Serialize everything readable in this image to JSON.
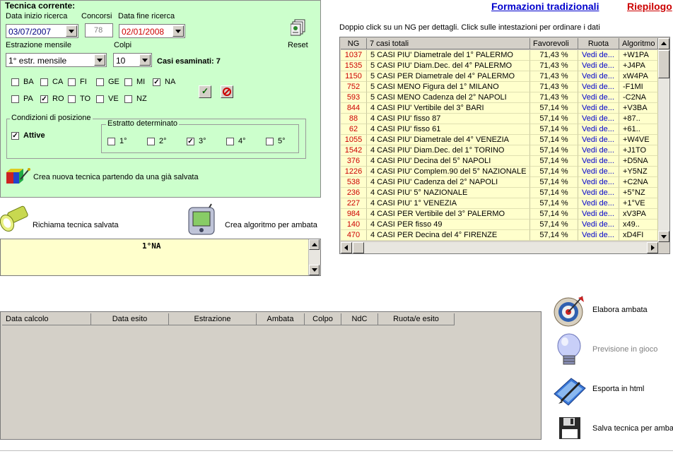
{
  "top_links": {
    "formazioni": "Formazioni tradizionali",
    "riepilogo": "Riepilogo"
  },
  "colors": {
    "panel_bg": "#ccffcc",
    "grid_bg": "#ffffcc",
    "link_blue": "#0000cc",
    "link_red": "#cc0000",
    "ng_red": "#cc0000",
    "ruota_blue": "#0000cc"
  },
  "tecnica": {
    "title": "Tecnica corrente:",
    "data_inizio_label": "Data inizio ricerca",
    "data_inizio_value": "03/07/2007",
    "concorsi_label": "Concorsi",
    "concorsi_value": "78",
    "data_fine_label": "Data fine ricerca",
    "data_fine_value": "02/01/2008",
    "reset_label": "Reset",
    "estrazione_label": "Estrazione mensile",
    "estrazione_value": "1° estr. mensile",
    "colpi_label": "Colpi",
    "colpi_value": "10",
    "casi_esaminati": "Casi esaminati: 7",
    "ruote": [
      {
        "name": "BA",
        "checked": false
      },
      {
        "name": "CA",
        "checked": false
      },
      {
        "name": "FI",
        "checked": false
      },
      {
        "name": "GE",
        "checked": false
      },
      {
        "name": "MI",
        "checked": false
      },
      {
        "name": "NA",
        "checked": true
      },
      {
        "name": "PA",
        "checked": false
      },
      {
        "name": "RO",
        "checked": true
      },
      {
        "name": "TO",
        "checked": false
      },
      {
        "name": "VE",
        "checked": false
      },
      {
        "name": "NZ",
        "checked": false
      }
    ],
    "condizioni_title": "Condizioni di posizione",
    "attive_label": "Attive",
    "attive_checked": true,
    "estratto_title": "Estratto determinato",
    "estratti": [
      {
        "label": "1°",
        "checked": false
      },
      {
        "label": "2°",
        "checked": false
      },
      {
        "label": "3°",
        "checked": true
      },
      {
        "label": "4°",
        "checked": false
      },
      {
        "label": "5°",
        "checked": false
      }
    ],
    "crea_nuova_label": "Crea nuova tecnica partendo da una già salvata"
  },
  "richiama_label": "Richiama tecnica salvata",
  "crea_algoritmo_label": "Crea algoritmo per ambata",
  "textarea_value": "1°NA",
  "instructions": "Doppio click su un NG per dettagli. Click sulle intestazioni per ordinare i dati",
  "casi_table": {
    "headers": [
      "NG",
      "7 casi totali",
      "Favorevoli",
      "Ruota",
      "Algoritmo"
    ],
    "rows": [
      {
        "ng": "1037",
        "desc": "5 CASI PIU' Diametrale del 1° PALERMO",
        "fav": "71,43 %",
        "ruota": "Vedi de...",
        "alg": "+W1PA"
      },
      {
        "ng": "1535",
        "desc": "5 CASI PIU' Diam.Dec. del 4° PALERMO",
        "fav": "71,43 %",
        "ruota": "Vedi de...",
        "alg": "+J4PA"
      },
      {
        "ng": "1150",
        "desc": "5 CASI PER Diametrale del 4° PALERMO",
        "fav": "71,43 %",
        "ruota": "Vedi de...",
        "alg": "xW4PA"
      },
      {
        "ng": "752",
        "desc": "5 CASI MENO Figura del 1° MILANO",
        "fav": "71,43 %",
        "ruota": "Vedi de...",
        "alg": "-F1MI"
      },
      {
        "ng": "593",
        "desc": "5 CASI MENO Cadenza del 2° NAPOLI",
        "fav": "71,43 %",
        "ruota": "Vedi de...",
        "alg": "-C2NA"
      },
      {
        "ng": "844",
        "desc": "4 CASI PIU' Vertibile del 3° BARI",
        "fav": "57,14 %",
        "ruota": "Vedi de...",
        "alg": "+V3BA"
      },
      {
        "ng": "88",
        "desc": "4 CASI PIU' fisso 87",
        "fav": "57,14 %",
        "ruota": "Vedi de...",
        "alg": "+87.."
      },
      {
        "ng": "62",
        "desc": "4 CASI PIU' fisso 61",
        "fav": "57,14 %",
        "ruota": "Vedi de...",
        "alg": "+61.."
      },
      {
        "ng": "1055",
        "desc": "4 CASI PIU' Diametrale del 4° VENEZIA",
        "fav": "57,14 %",
        "ruota": "Vedi de...",
        "alg": "+W4VE"
      },
      {
        "ng": "1542",
        "desc": "4 CASI PIU' Diam.Dec. del 1° TORINO",
        "fav": "57,14 %",
        "ruota": "Vedi de...",
        "alg": "+J1TO"
      },
      {
        "ng": "376",
        "desc": "4 CASI PIU' Decina del 5° NAPOLI",
        "fav": "57,14 %",
        "ruota": "Vedi de...",
        "alg": "+D5NA"
      },
      {
        "ng": "1226",
        "desc": "4 CASI PIU' Complem.90 del 5° NAZIONALE",
        "fav": "57,14 %",
        "ruota": "Vedi de...",
        "alg": "+Y5NZ"
      },
      {
        "ng": "538",
        "desc": "4 CASI PIU' Cadenza del 2° NAPOLI",
        "fav": "57,14 %",
        "ruota": "Vedi de...",
        "alg": "+C2NA"
      },
      {
        "ng": "236",
        "desc": "4 CASI PIU' 5° NAZIONALE",
        "fav": "57,14 %",
        "ruota": "Vedi de...",
        "alg": "+5°NZ"
      },
      {
        "ng": "227",
        "desc": "4 CASI PIU' 1° VENEZIA",
        "fav": "57,14 %",
        "ruota": "Vedi de...",
        "alg": "+1°VE"
      },
      {
        "ng": "984",
        "desc": "4 CASI PER Vertibile del 3° PALERMO",
        "fav": "57,14 %",
        "ruota": "Vedi de...",
        "alg": "xV3PA"
      },
      {
        "ng": "140",
        "desc": "4 CASI PER fisso 49",
        "fav": "57,14 %",
        "ruota": "Vedi de...",
        "alg": "x49.."
      },
      {
        "ng": "470",
        "desc": "4 CASI PER Decina del 4° FIRENZE",
        "fav": "57,14 %",
        "ruota": "Vedi de...",
        "alg": "xD4FI"
      }
    ]
  },
  "risultati_table": {
    "headers": [
      "Data calcolo",
      "Data esito",
      "Estrazione",
      "Ambata",
      "Colpo",
      "NdC",
      "Ruota/e esito"
    ]
  },
  "actions": {
    "elabora": "Elabora ambata",
    "previsione": "Previsione in gioco",
    "esporta": "Esporta in html",
    "salva": "Salva tecnica per ambata"
  },
  "icons": {
    "reset": "document-stack-icon",
    "crea_nuova": "cube-wand-icon",
    "richiama": "flashlight-icon",
    "crea_algoritmo": "handheld-device-icon",
    "elabora": "target-icon",
    "previsione": "lightbulb-icon",
    "esporta": "pen-book-icon",
    "salva": "floppy-disk-icon",
    "confirm": "checkmark-icon",
    "cancel": "no-entry-icon"
  }
}
